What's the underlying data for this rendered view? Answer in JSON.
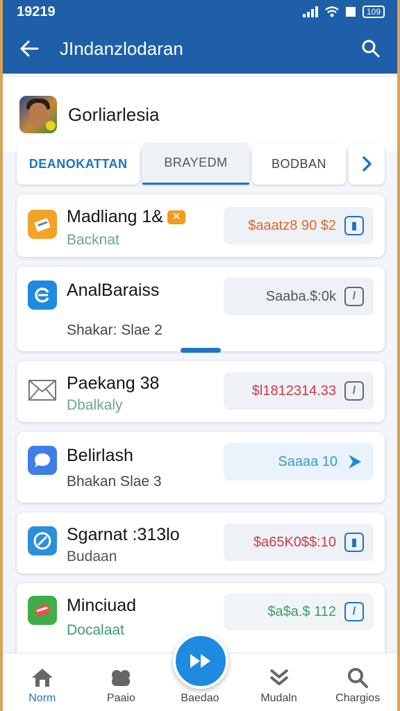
{
  "status_bar": {
    "time": "19219",
    "battery": "109"
  },
  "app_bar": {
    "title": "JIndanzlodaran"
  },
  "game": {
    "name": "Gorliarlesia"
  },
  "tabs": [
    {
      "label": "DEANOKATTAN",
      "state": "active"
    },
    {
      "label": "BRAYEDM",
      "state": "selected"
    },
    {
      "label": "BODBAN",
      "state": "normal"
    },
    {
      "label": "",
      "icon": "chevron-right-icon"
    }
  ],
  "items": [
    {
      "name": "Madliang 1&",
      "tag": "✕",
      "sub": "Backnat",
      "sub_color": "#6aa98a",
      "price": "$aaatz8 90 $2",
      "price_color": "#e0662b",
      "icon": "book-orange-icon",
      "action_icon": "edit-box-icon"
    },
    {
      "name": "AnalBaraiss",
      "sub": "Shakar: Slae 2",
      "sub_color": "#444444",
      "price": "Saaba.$:0k",
      "price_color": "#555555",
      "icon": "refresh-blue-icon",
      "action_icon": "edit-box-icon"
    },
    {
      "name": "Paekang 38",
      "sub": "Dbalkaly",
      "sub_color": "#6aa98a",
      "price": "$l1812314.33",
      "price_color": "#d6364a",
      "icon": "envelope-icon",
      "action_icon": "edit-box-icon"
    },
    {
      "name": "Belirlash",
      "sub": "Bhakan Slae 3",
      "sub_color": "#444444",
      "price": "Saaaa 10",
      "price_color": "#2f9bd6",
      "icon": "chat-blue-icon",
      "action_icon": "arrow-right-icon"
    },
    {
      "name": "Sgarnat :313lo",
      "sub": "Budaan",
      "sub_color": "#555555",
      "price": "$a65K0$$:10",
      "price_color": "#d6364a",
      "icon": "disc-blue-icon",
      "action_icon": "edit-box-icon"
    },
    {
      "name": "Minciuad",
      "sub": "Docalaat",
      "sub_color": "#3f9a6a",
      "price": "$a$a.$ 112",
      "price_color": "#3f9a6a",
      "icon": "book-green-icon",
      "action_icon": "pencil-icon"
    }
  ],
  "bottom_nav": [
    {
      "label": "Norm",
      "icon": "home-icon",
      "active": true
    },
    {
      "label": "Paaio",
      "icon": "gamepad-icon",
      "active": false
    },
    {
      "label": "Baedao",
      "icon": "fast-forward-icon",
      "active": false
    },
    {
      "label": "Mudaln",
      "icon": "chevrons-down-icon",
      "active": false
    },
    {
      "label": "Chargios",
      "icon": "search-icon",
      "active": false
    }
  ],
  "colors": {
    "primary": "#1e5fa8",
    "accent": "#1e73c4",
    "fab": "#1e8ae0"
  }
}
